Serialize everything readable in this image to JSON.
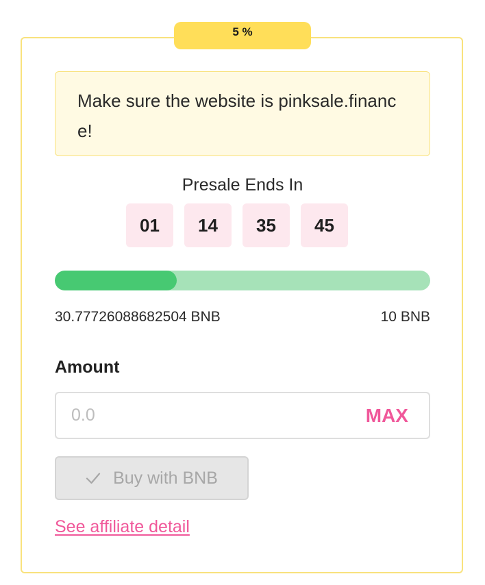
{
  "badge": {
    "label": "5 %"
  },
  "warning": {
    "text": "Make sure the website is pinksale.finance!"
  },
  "presale": {
    "title": "Presale Ends In",
    "countdown": [
      "01",
      "14",
      "35",
      "45"
    ]
  },
  "progress": {
    "fraction": 0.325,
    "raised_label": "30.77726088682504 BNB",
    "goal_label": "10 BNB"
  },
  "amount": {
    "label": "Amount",
    "placeholder": "0.0",
    "value": "",
    "max_label": "MAX"
  },
  "buy_button": {
    "label": "Buy with BNB",
    "icon": "check-icon",
    "disabled": true
  },
  "affiliate": {
    "label": "See affiliate detail"
  },
  "colors": {
    "accent_pink": "#f0589a",
    "badge_yellow": "#ffde59",
    "progress_fill": "#47c972",
    "progress_track": "#a6e2b8",
    "card_border": "#f9e27d"
  }
}
